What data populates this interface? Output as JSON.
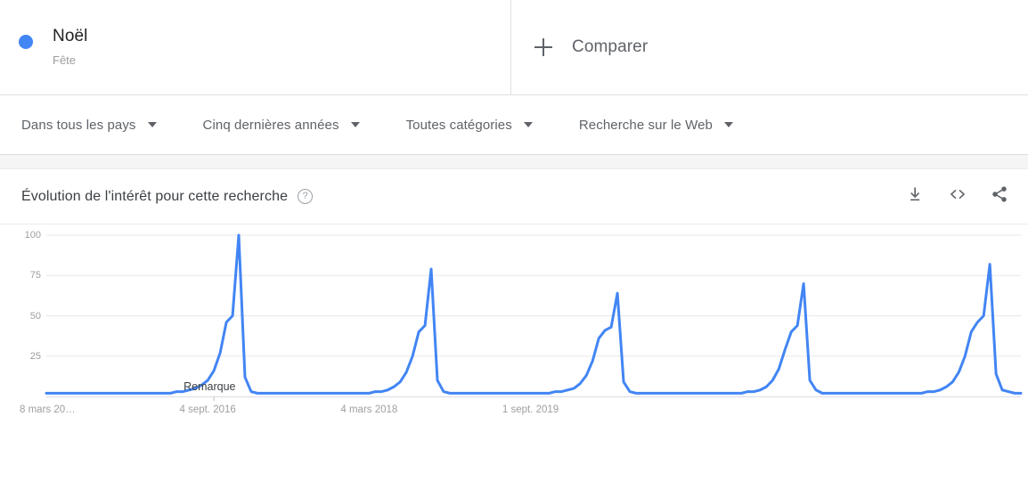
{
  "term": {
    "name": "Noël",
    "category": "Fête",
    "dot_color": "#4285f4"
  },
  "compare": {
    "label": "Comparer",
    "icon": "plus-icon"
  },
  "filters": [
    {
      "label": "Dans tous les pays"
    },
    {
      "label": "Cinq dernières années"
    },
    {
      "label": "Toutes catégories"
    },
    {
      "label": "Recherche sur le Web"
    }
  ],
  "card": {
    "title": "Évolution de l'intérêt pour cette recherche",
    "help_icon": "?",
    "actions": [
      {
        "name": "download-icon"
      },
      {
        "name": "embed-code-icon"
      },
      {
        "name": "share-icon"
      }
    ]
  },
  "chart_data": {
    "type": "line",
    "title": "Évolution de l'intérêt pour cette recherche",
    "xlabel": "",
    "ylabel": "",
    "ylim": [
      0,
      100
    ],
    "yticks": [
      25,
      50,
      75,
      100
    ],
    "grid": true,
    "legend_position": "top",
    "line_color": "#4285f4",
    "line_width": 3,
    "annotations": [
      {
        "text": "Remarque",
        "x_index": 27,
        "y": 6
      }
    ],
    "xticks": [
      {
        "label": "8 mars 20…",
        "x_index": 0
      },
      {
        "label": "4 sept. 2016",
        "x_index": 26
      },
      {
        "label": "4 mars 2018",
        "x_index": 52
      },
      {
        "label": "1 sept. 2019",
        "x_index": 78
      }
    ],
    "series": [
      {
        "name": "Noël",
        "color": "#4285f4",
        "values": [
          2,
          2,
          2,
          2,
          2,
          2,
          2,
          2,
          2,
          2,
          2,
          2,
          2,
          2,
          2,
          2,
          2,
          2,
          2,
          2,
          2,
          3,
          3,
          4,
          5,
          7,
          10,
          16,
          27,
          46,
          50,
          100,
          12,
          3,
          2,
          2,
          2,
          2,
          2,
          2,
          2,
          2,
          2,
          2,
          2,
          2,
          2,
          2,
          2,
          2,
          2,
          2,
          2,
          3,
          3,
          4,
          6,
          9,
          15,
          25,
          40,
          44,
          79,
          10,
          3,
          2,
          2,
          2,
          2,
          2,
          2,
          2,
          2,
          2,
          2,
          2,
          2,
          2,
          2,
          2,
          2,
          2,
          3,
          3,
          4,
          5,
          8,
          13,
          22,
          36,
          41,
          43,
          64,
          9,
          3,
          2,
          2,
          2,
          2,
          2,
          2,
          2,
          2,
          2,
          2,
          2,
          2,
          2,
          2,
          2,
          2,
          2,
          2,
          3,
          3,
          4,
          6,
          10,
          17,
          29,
          40,
          44,
          70,
          10,
          4,
          2,
          2,
          2,
          2,
          2,
          2,
          2,
          2,
          2,
          2,
          2,
          2,
          2,
          2,
          2,
          2,
          2,
          3,
          3,
          4,
          6,
          9,
          15,
          25,
          40,
          46,
          50,
          82,
          14,
          4,
          3,
          2,
          2
        ]
      }
    ]
  }
}
